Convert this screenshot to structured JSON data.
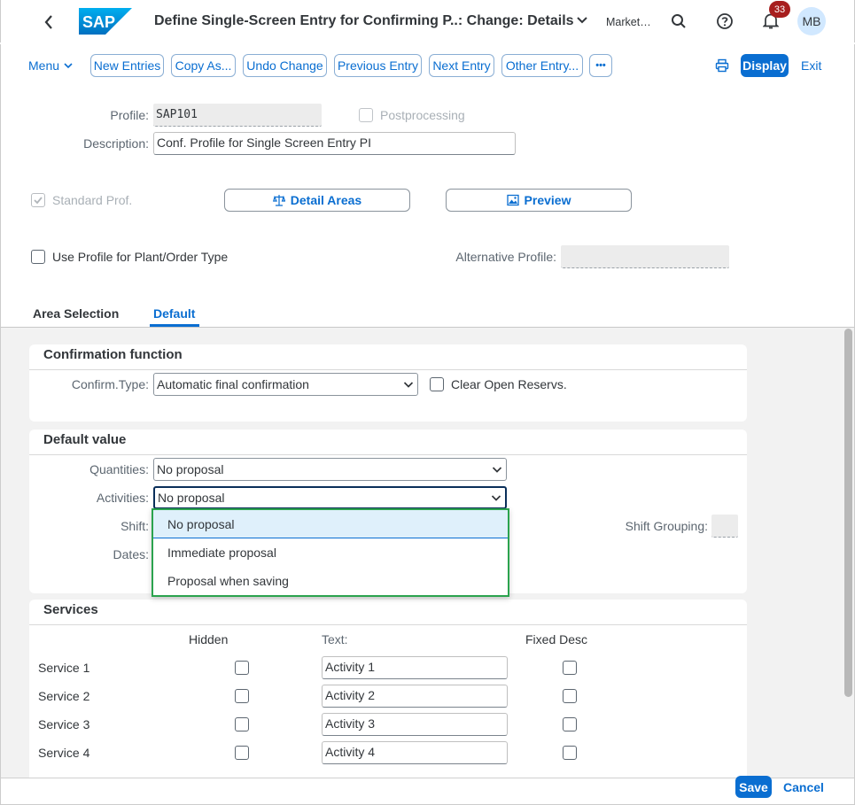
{
  "shell": {
    "logo_text": "SAP",
    "title": "Define Single-Screen Entry for Confirming P..: Change: Details",
    "market": "Market…",
    "notification_count": "33",
    "avatar_initials": "MB"
  },
  "toolbar": {
    "menu": "Menu",
    "buttons": [
      "New Entries",
      "Copy As...",
      "Undo Change",
      "Previous Entry",
      "Next Entry",
      "Other Entry..."
    ],
    "more": "•••",
    "display": "Display",
    "exit": "Exit"
  },
  "form": {
    "profile_label": "Profile:",
    "profile_value": "SAP101",
    "postprocessing_label": "Postprocessing",
    "description_label": "Description:",
    "description_value": "Conf. Profile for Single Screen Entry PI",
    "standard_prof_label": "Standard Prof.",
    "detail_areas": "Detail Areas",
    "preview": "Preview",
    "use_profile_label": "Use Profile for Plant/Order Type",
    "alt_profile_label": "Alternative Profile:",
    "alt_profile_value": ""
  },
  "tabs": [
    "Area Selection",
    "Default"
  ],
  "active_tab": "Default",
  "confirmation": {
    "title": "Confirmation function",
    "confirm_type_label": "Confirm.Type:",
    "confirm_type_value": "Automatic final confirmation",
    "clear_reservs_label": "Clear Open Reservs."
  },
  "default_value": {
    "title": "Default value",
    "quantities_label": "Quantities:",
    "quantities_value": "No proposal",
    "activities_label": "Activities:",
    "activities_value": "No proposal",
    "shift_label": "Shift:",
    "dates_label": "Dates:",
    "shift_grouping_label": "Shift Grouping:"
  },
  "dropdown": {
    "options": [
      "No proposal",
      "Immediate proposal",
      "Proposal when saving"
    ],
    "selected": "No proposal"
  },
  "services": {
    "title": "Services",
    "col_hidden": "Hidden",
    "col_text": "Text:",
    "col_fixed": "Fixed Desc",
    "rows": [
      {
        "label": "Service 1",
        "text": "Activity 1"
      },
      {
        "label": "Service 2",
        "text": "Activity 2"
      },
      {
        "label": "Service 3",
        "text": "Activity 3"
      },
      {
        "label": "Service 4",
        "text": "Activity 4"
      }
    ]
  },
  "footer": {
    "save": "Save",
    "cancel": "Cancel"
  },
  "colors": {
    "accent": "#0a6ed1",
    "badge": "#a71e1e",
    "dropdown_highlight": "#2ba34e"
  }
}
